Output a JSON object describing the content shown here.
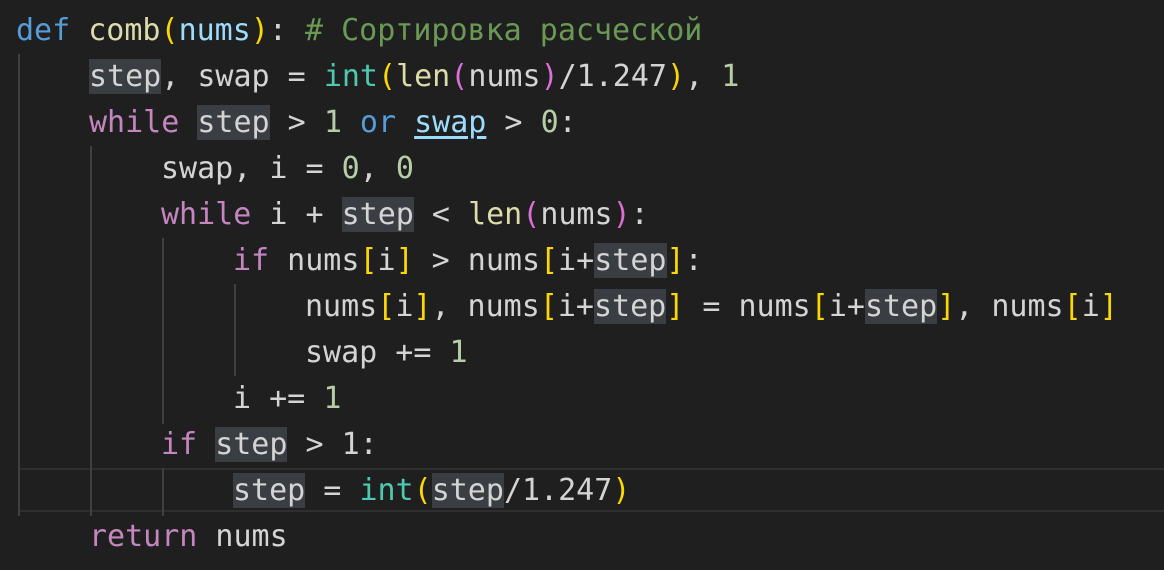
{
  "editor": {
    "lines": [
      {
        "tokens": [
          "def",
          "comb",
          "(",
          "nums",
          ")",
          ":",
          "# Сортировка расческой"
        ]
      },
      {
        "tokens": [
          "step",
          ", swap = ",
          "int",
          "(",
          "len",
          "(",
          "nums",
          ")",
          "/1.247",
          ")",
          ", ",
          "1"
        ]
      },
      {
        "tokens": [
          "while",
          "step",
          " > ",
          "1",
          " or ",
          "swap",
          " > ",
          "0",
          ":"
        ]
      },
      {
        "tokens": [
          "swap, i = ",
          "0",
          ", ",
          "0"
        ]
      },
      {
        "tokens": [
          "while",
          " i + ",
          "step",
          " < ",
          "len",
          "(",
          "nums",
          ")",
          ":"
        ]
      },
      {
        "tokens": [
          "if",
          " nums",
          "[",
          "i",
          "]",
          " > nums",
          "[",
          "i+",
          "step",
          "]",
          ":"
        ]
      },
      {
        "tokens": [
          "nums",
          "[",
          "i",
          "]",
          ", nums",
          "[",
          "i+",
          "step",
          "]",
          " = nums",
          "[",
          "i+",
          "step",
          "]",
          ", nums",
          "[",
          "i",
          "]"
        ]
      },
      {
        "tokens": [
          "swap += ",
          "1"
        ]
      },
      {
        "tokens": [
          "i += ",
          "1"
        ]
      },
      {
        "tokens": [
          "if",
          " ",
          "step",
          " > 1:"
        ]
      },
      {
        "tokens": [
          "step",
          " = ",
          "int",
          "(",
          "step",
          "/1.247",
          ")"
        ]
      },
      {
        "tokens": [
          "return",
          " nums"
        ]
      }
    ]
  },
  "colors": {
    "background": "#1f1f1f",
    "keyword_def": "#569cd6",
    "keyword_control": "#c586c0",
    "function": "#dcdcaa",
    "variable": "#9cdcfe",
    "number": "#b5cea8",
    "comment": "#6a9955",
    "builtin": "#4ec9b0",
    "bracket": "#ffd700",
    "selection_highlight": "#3a3d41"
  }
}
